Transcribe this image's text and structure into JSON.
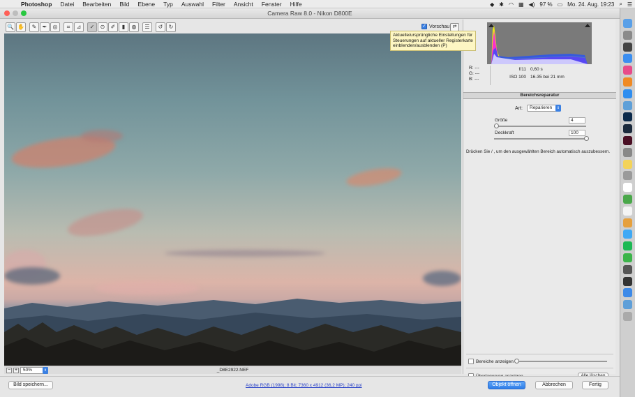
{
  "menubar": {
    "app": "Photoshop",
    "items": [
      "Datei",
      "Bearbeiten",
      "Bild",
      "Ebene",
      "Typ",
      "Auswahl",
      "Filter",
      "Ansicht",
      "Fenster",
      "Hilfe"
    ],
    "battery": "97 %",
    "datetime": "Mo. 24. Aug.  19:23"
  },
  "window": {
    "title": "Camera Raw 8.0 - Nikon D800E"
  },
  "toolbar": {
    "tools": [
      {
        "name": "zoom-tool-icon",
        "glyph": "🔍"
      },
      {
        "name": "hand-tool-icon",
        "glyph": "✋"
      },
      {
        "name": "white-balance-tool-icon",
        "glyph": "✎"
      },
      {
        "name": "color-sampler-tool-icon",
        "glyph": "✒"
      },
      {
        "name": "targeted-adjustment-tool-icon",
        "glyph": "◎"
      },
      {
        "name": "crop-tool-icon",
        "glyph": "⌗"
      },
      {
        "name": "straighten-tool-icon",
        "glyph": "⊿"
      },
      {
        "name": "spot-removal-tool-icon",
        "glyph": "✓"
      },
      {
        "name": "red-eye-tool-icon",
        "glyph": "⊙"
      },
      {
        "name": "adjustment-brush-icon",
        "glyph": "✐"
      },
      {
        "name": "graduated-filter-icon",
        "glyph": "▮"
      },
      {
        "name": "radial-filter-icon",
        "glyph": "◍"
      },
      {
        "name": "preferences-icon",
        "glyph": "☰"
      },
      {
        "name": "rotate-left-icon",
        "glyph": "↺"
      },
      {
        "name": "rotate-right-icon",
        "glyph": "↻"
      }
    ],
    "preview_label": "Vorschau",
    "tooltip": "Aktuelle/ursprüngliche Einstellungen für Steuerungen auf aktueller Registerkarte einblenden/ausblenden (P)"
  },
  "statusbar": {
    "zoom": "50%",
    "filename": "_D8E2922.NEF"
  },
  "info": {
    "r_label": "R:",
    "r_value": "---",
    "g_label": "G:",
    "g_value": "---",
    "b_label": "B:",
    "b_value": "---",
    "aperture": "f/11",
    "shutter": "0,60 s",
    "iso": "ISO 100",
    "lens": "16-35 bei 21 mm"
  },
  "panel": {
    "title": "Bereichsreparatur",
    "type_label": "Art:",
    "type_value": "Reparieren",
    "size_label": "Größe",
    "size_value": "4",
    "size_fraction": 0.03,
    "opacity_label": "Deckkraft",
    "opacity_value": "100",
    "opacity_fraction": 1.0,
    "hint": "Drücken Sie / , um den ausgewählten Bereich automatisch auszubessern.",
    "show_spots_label": "Bereiche anzeigen",
    "show_overlay_label": "Überlagerung anzeigen",
    "clear_all_label": "Alle löschen"
  },
  "bottom": {
    "save_label": "Bild speichern...",
    "workflow_link": "Adobe RGB (1998); 8 Bit; 7360 x 4912 (36,2 MP); 240 ppi",
    "open_label": "Objekt öffnen",
    "cancel_label": "Abbrechen",
    "done_label": "Fertig"
  },
  "dock": [
    "finder-icon",
    "launchpad-icon",
    "mission-control-icon",
    "app-store-icon",
    "itunes-icon",
    "ibooks-icon",
    "safari-icon",
    "preview-icon",
    "photoshop-icon",
    "lightroom-icon",
    "indesign-icon",
    "system-preferences-icon",
    "notes-icon",
    "image-capture-icon",
    "calendar-icon",
    "evernote-icon",
    "textedit-icon",
    "photos-icon",
    "messages-icon",
    "spotify-icon",
    "facetime-icon",
    "time-machine-icon",
    "activity-monitor-icon",
    "dropbox-icon",
    "downloads-icon",
    "trash-icon"
  ]
}
